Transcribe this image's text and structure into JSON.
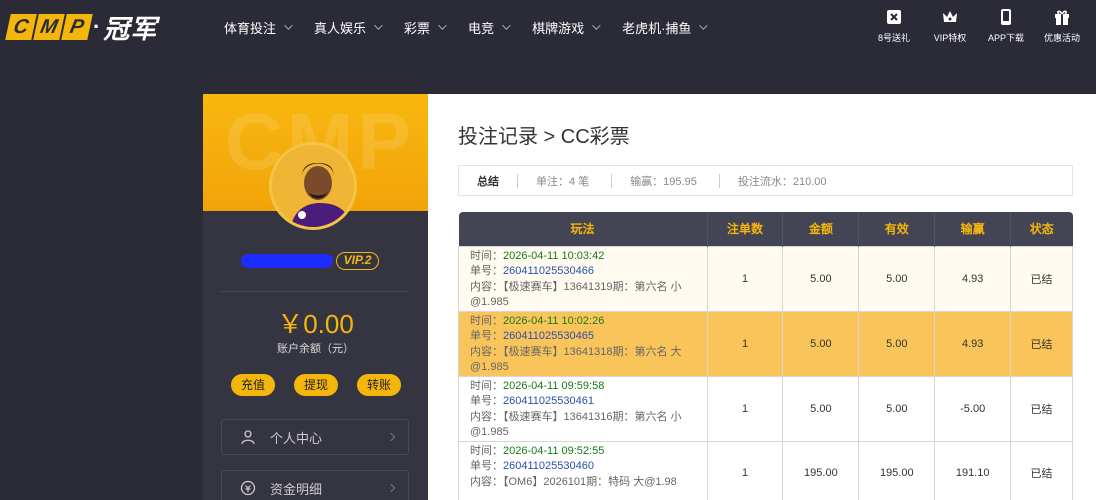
{
  "logo": {
    "cmp_letters": [
      "C",
      "M",
      "P"
    ],
    "dot": "·",
    "cn": "冠军"
  },
  "nav": {
    "items": [
      "体育投注",
      "真人娱乐",
      "彩票",
      "电竞",
      "棋牌游戏",
      "老虎机·捕鱼"
    ]
  },
  "topright": {
    "items": [
      "8号送礼",
      "VIP特权",
      "APP下载",
      "优惠活动"
    ]
  },
  "profile": {
    "vip": "VIP.2",
    "balance": "￥0.00",
    "balance_label": "账户余额（元）",
    "buttons": [
      "充值",
      "提现",
      "转账"
    ],
    "menu": [
      "个人中心",
      "资金明细"
    ]
  },
  "main": {
    "title": "投注记录 > CC彩票",
    "summary": {
      "label": "总结",
      "bets": "单注：4 笔",
      "winloss": "输赢：195.95",
      "turnover": "投注流水：210.00"
    },
    "columns": [
      "玩法",
      "注单数",
      "金额",
      "有效",
      "输赢",
      "状态"
    ],
    "rows": [
      {
        "time_label": "时间：",
        "time": "2026-04-11 10:03:42",
        "order_label": "单号：",
        "order": "260411025530466",
        "content_label": "内容：",
        "content": "【极速赛车】13641319期：第六名 小@1.985",
        "count": "1",
        "amount": "5.00",
        "valid": "5.00",
        "winloss": "4.93",
        "status": "已结"
      },
      {
        "time_label": "时间：",
        "time": "2026-04-11 10:02:26",
        "order_label": "单号：",
        "order": "260411025530465",
        "content_label": "内容：",
        "content": "【极速赛车】13641318期：第六名 大@1.985",
        "count": "1",
        "amount": "5.00",
        "valid": "5.00",
        "winloss": "4.93",
        "status": "已结"
      },
      {
        "time_label": "时间：",
        "time": "2026-04-11 09:59:58",
        "order_label": "单号：",
        "order": "260411025530461",
        "content_label": "内容：",
        "content": "【极速赛车】13641316期：第六名 小@1.985",
        "count": "1",
        "amount": "5.00",
        "valid": "5.00",
        "winloss": "-5.00",
        "status": "已结"
      },
      {
        "time_label": "时间：",
        "time": "2026-04-11 09:52:55",
        "order_label": "单号：",
        "order": "260411025530460",
        "content_label": "内容：",
        "content": "【OM6】2026101期：特码 大@1.98",
        "count": "1",
        "amount": "195.00",
        "valid": "195.00",
        "winloss": "191.10",
        "status": "已结"
      }
    ]
  }
}
